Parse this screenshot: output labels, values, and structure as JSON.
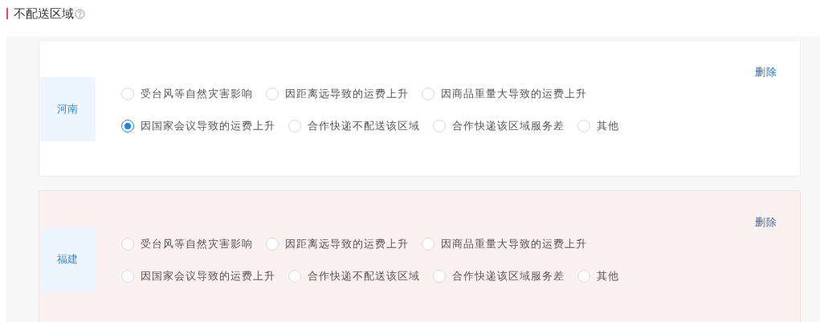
{
  "section": {
    "title": "不配送区域",
    "help_icon": true
  },
  "regions": [
    {
      "province": "河南",
      "highlighted": false,
      "delete_label": "删除",
      "reasons": [
        {
          "label": "受台风等自然灾害影响",
          "selected": false
        },
        {
          "label": "因距离远导致的运费上升",
          "selected": false
        },
        {
          "label": "因商品重量大导致的运费上升",
          "selected": false
        },
        {
          "label": "因国家会议导致的运费上升",
          "selected": true
        },
        {
          "label": "合作快递不配送该区域",
          "selected": false
        },
        {
          "label": "合作快递该区域服务差",
          "selected": false
        },
        {
          "label": "其他",
          "selected": false
        }
      ]
    },
    {
      "province": "福建",
      "highlighted": true,
      "delete_label": "删除",
      "reasons": [
        {
          "label": "受台风等自然灾害影响",
          "selected": false
        },
        {
          "label": "因距离远导致的运费上升",
          "selected": false
        },
        {
          "label": "因商品重量大导致的运费上升",
          "selected": false
        },
        {
          "label": "因国家会议导致的运费上升",
          "selected": false
        },
        {
          "label": "合作快递不配送该区域",
          "selected": false
        },
        {
          "label": "合作快递该区域服务差",
          "selected": false
        },
        {
          "label": "其他",
          "selected": false
        }
      ]
    }
  ]
}
